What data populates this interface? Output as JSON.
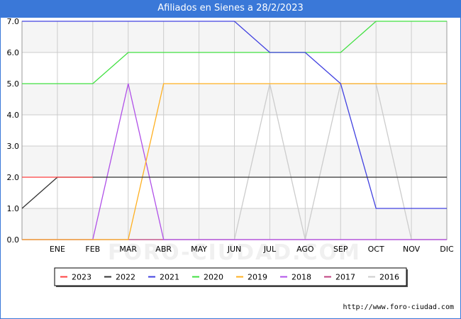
{
  "title": "Afiliados en Sienes a 28/2/2023",
  "source": "http://www.foro-ciudad.com",
  "watermark": "FORO-CIUDAD.COM",
  "colors": {
    "title_bg": "#3a78d8",
    "band": "#f5f5f5",
    "grid": "#cccccc"
  },
  "chart_data": {
    "type": "line",
    "categories": [
      "",
      "ENE",
      "FEB",
      "MAR",
      "ABR",
      "MAY",
      "JUN",
      "JUL",
      "AGO",
      "SEP",
      "OCT",
      "NOV",
      "DIC"
    ],
    "yticks": [
      "0.0",
      "1.0",
      "2.0",
      "3.0",
      "4.0",
      "5.0",
      "6.0",
      "7.0"
    ],
    "ylim": [
      0,
      7
    ],
    "grid": true,
    "legend_position": "bottom",
    "series": [
      {
        "name": "2023",
        "color": "#ff4040",
        "values": [
          2,
          2,
          2,
          null,
          null,
          null,
          null,
          null,
          null,
          null,
          null,
          null,
          null
        ]
      },
      {
        "name": "2022",
        "color": "#333333",
        "values": [
          1,
          2,
          2,
          2,
          2,
          2,
          2,
          2,
          2,
          2,
          2,
          2,
          2
        ]
      },
      {
        "name": "2021",
        "color": "#4040e0",
        "values": [
          7,
          7,
          7,
          7,
          7,
          7,
          7,
          6,
          6,
          5,
          1,
          1,
          1
        ]
      },
      {
        "name": "2020",
        "color": "#40e040",
        "values": [
          5,
          5,
          5,
          6,
          6,
          6,
          6,
          6,
          6,
          6,
          7,
          7,
          7
        ]
      },
      {
        "name": "2019",
        "color": "#ffb020",
        "values": [
          0,
          0,
          0,
          0,
          5,
          5,
          5,
          5,
          5,
          5,
          5,
          5,
          5
        ]
      },
      {
        "name": "2018",
        "color": "#b050e8",
        "values": [
          0,
          0,
          0,
          5,
          0,
          0,
          0,
          0,
          0,
          0,
          0,
          0,
          0
        ]
      },
      {
        "name": "2017",
        "color": "#c04080",
        "values": [
          0,
          0,
          0,
          0,
          0,
          0,
          0,
          0,
          0,
          0,
          0,
          0,
          0
        ]
      },
      {
        "name": "2016",
        "color": "#cccccc",
        "values": [
          0,
          0,
          0,
          0,
          0,
          0,
          0,
          5,
          0,
          5,
          5,
          0,
          0
        ]
      }
    ]
  }
}
